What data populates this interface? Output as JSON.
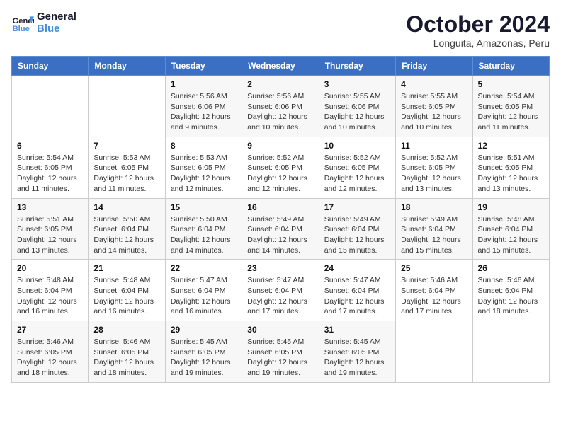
{
  "logo": {
    "line1": "General",
    "line2": "Blue"
  },
  "title": "October 2024",
  "location": "Longuita, Amazonas, Peru",
  "weekdays": [
    "Sunday",
    "Monday",
    "Tuesday",
    "Wednesday",
    "Thursday",
    "Friday",
    "Saturday"
  ],
  "weeks": [
    [
      {
        "day": "",
        "info": ""
      },
      {
        "day": "",
        "info": ""
      },
      {
        "day": "1",
        "info": "Sunrise: 5:56 AM\nSunset: 6:06 PM\nDaylight: 12 hours and 9 minutes."
      },
      {
        "day": "2",
        "info": "Sunrise: 5:56 AM\nSunset: 6:06 PM\nDaylight: 12 hours and 10 minutes."
      },
      {
        "day": "3",
        "info": "Sunrise: 5:55 AM\nSunset: 6:06 PM\nDaylight: 12 hours and 10 minutes."
      },
      {
        "day": "4",
        "info": "Sunrise: 5:55 AM\nSunset: 6:05 PM\nDaylight: 12 hours and 10 minutes."
      },
      {
        "day": "5",
        "info": "Sunrise: 5:54 AM\nSunset: 6:05 PM\nDaylight: 12 hours and 11 minutes."
      }
    ],
    [
      {
        "day": "6",
        "info": "Sunrise: 5:54 AM\nSunset: 6:05 PM\nDaylight: 12 hours and 11 minutes."
      },
      {
        "day": "7",
        "info": "Sunrise: 5:53 AM\nSunset: 6:05 PM\nDaylight: 12 hours and 11 minutes."
      },
      {
        "day": "8",
        "info": "Sunrise: 5:53 AM\nSunset: 6:05 PM\nDaylight: 12 hours and 12 minutes."
      },
      {
        "day": "9",
        "info": "Sunrise: 5:52 AM\nSunset: 6:05 PM\nDaylight: 12 hours and 12 minutes."
      },
      {
        "day": "10",
        "info": "Sunrise: 5:52 AM\nSunset: 6:05 PM\nDaylight: 12 hours and 12 minutes."
      },
      {
        "day": "11",
        "info": "Sunrise: 5:52 AM\nSunset: 6:05 PM\nDaylight: 12 hours and 13 minutes."
      },
      {
        "day": "12",
        "info": "Sunrise: 5:51 AM\nSunset: 6:05 PM\nDaylight: 12 hours and 13 minutes."
      }
    ],
    [
      {
        "day": "13",
        "info": "Sunrise: 5:51 AM\nSunset: 6:05 PM\nDaylight: 12 hours and 13 minutes."
      },
      {
        "day": "14",
        "info": "Sunrise: 5:50 AM\nSunset: 6:04 PM\nDaylight: 12 hours and 14 minutes."
      },
      {
        "day": "15",
        "info": "Sunrise: 5:50 AM\nSunset: 6:04 PM\nDaylight: 12 hours and 14 minutes."
      },
      {
        "day": "16",
        "info": "Sunrise: 5:49 AM\nSunset: 6:04 PM\nDaylight: 12 hours and 14 minutes."
      },
      {
        "day": "17",
        "info": "Sunrise: 5:49 AM\nSunset: 6:04 PM\nDaylight: 12 hours and 15 minutes."
      },
      {
        "day": "18",
        "info": "Sunrise: 5:49 AM\nSunset: 6:04 PM\nDaylight: 12 hours and 15 minutes."
      },
      {
        "day": "19",
        "info": "Sunrise: 5:48 AM\nSunset: 6:04 PM\nDaylight: 12 hours and 15 minutes."
      }
    ],
    [
      {
        "day": "20",
        "info": "Sunrise: 5:48 AM\nSunset: 6:04 PM\nDaylight: 12 hours and 16 minutes."
      },
      {
        "day": "21",
        "info": "Sunrise: 5:48 AM\nSunset: 6:04 PM\nDaylight: 12 hours and 16 minutes."
      },
      {
        "day": "22",
        "info": "Sunrise: 5:47 AM\nSunset: 6:04 PM\nDaylight: 12 hours and 16 minutes."
      },
      {
        "day": "23",
        "info": "Sunrise: 5:47 AM\nSunset: 6:04 PM\nDaylight: 12 hours and 17 minutes."
      },
      {
        "day": "24",
        "info": "Sunrise: 5:47 AM\nSunset: 6:04 PM\nDaylight: 12 hours and 17 minutes."
      },
      {
        "day": "25",
        "info": "Sunrise: 5:46 AM\nSunset: 6:04 PM\nDaylight: 12 hours and 17 minutes."
      },
      {
        "day": "26",
        "info": "Sunrise: 5:46 AM\nSunset: 6:04 PM\nDaylight: 12 hours and 18 minutes."
      }
    ],
    [
      {
        "day": "27",
        "info": "Sunrise: 5:46 AM\nSunset: 6:05 PM\nDaylight: 12 hours and 18 minutes."
      },
      {
        "day": "28",
        "info": "Sunrise: 5:46 AM\nSunset: 6:05 PM\nDaylight: 12 hours and 18 minutes."
      },
      {
        "day": "29",
        "info": "Sunrise: 5:45 AM\nSunset: 6:05 PM\nDaylight: 12 hours and 19 minutes."
      },
      {
        "day": "30",
        "info": "Sunrise: 5:45 AM\nSunset: 6:05 PM\nDaylight: 12 hours and 19 minutes."
      },
      {
        "day": "31",
        "info": "Sunrise: 5:45 AM\nSunset: 6:05 PM\nDaylight: 12 hours and 19 minutes."
      },
      {
        "day": "",
        "info": ""
      },
      {
        "day": "",
        "info": ""
      }
    ]
  ]
}
